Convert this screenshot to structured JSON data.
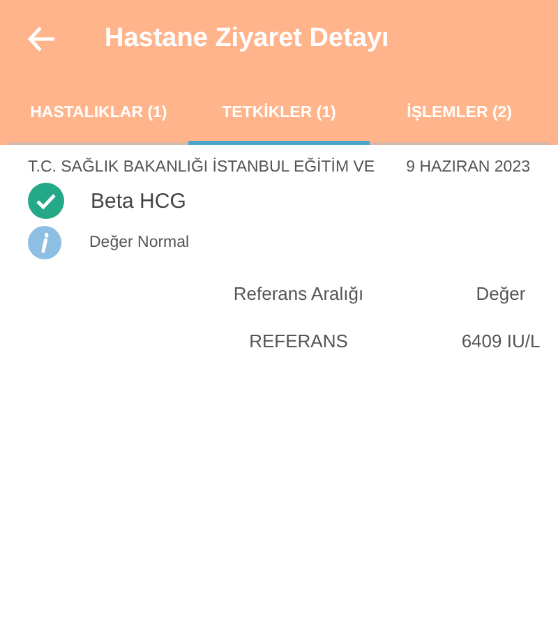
{
  "header": {
    "title": "Hastane Ziyaret Detayı"
  },
  "tabs": [
    {
      "label": "HASTALIKLAR (1)",
      "selected": false
    },
    {
      "label": "TETKİKLER (1)",
      "selected": true
    },
    {
      "label": "İŞLEMLER (2)",
      "selected": false
    }
  ],
  "visit": {
    "hospital": "T.C. SAĞLIK BAKANLIĞI İSTANBUL EĞİTİM VE",
    "date": "9 HAZIRAN 2023"
  },
  "test": {
    "name": "Beta HCG",
    "status": "Değer Normal",
    "normal": true
  },
  "table": {
    "columns": [
      "Referans Aralığı",
      "Değer"
    ],
    "rows": [
      [
        "REFERANS",
        "6409 IU/L"
      ]
    ]
  }
}
